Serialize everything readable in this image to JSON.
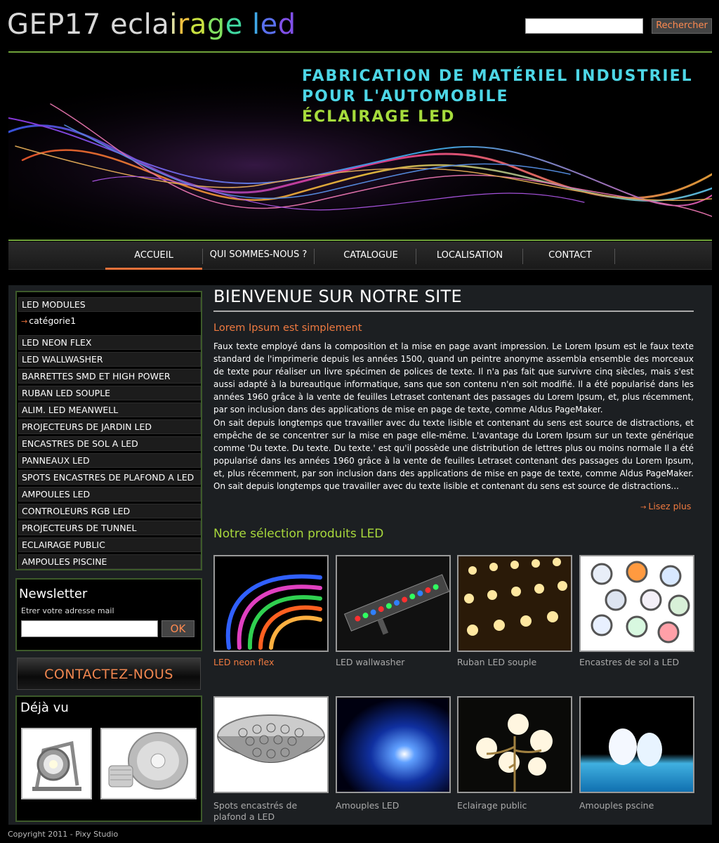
{
  "header": {
    "logo_parts": [
      {
        "text": "GEP17 ecla",
        "color": "#d8d8d8"
      },
      {
        "text": "i",
        "color": "#e0e0a0"
      },
      {
        "text": "r",
        "color": "#f0c040"
      },
      {
        "text": "a",
        "color": "#c8e040"
      },
      {
        "text": "g",
        "color": "#80e060"
      },
      {
        "text": "e ",
        "color": "#40d8a0"
      },
      {
        "text": "l",
        "color": "#40a8e8"
      },
      {
        "text": "e",
        "color": "#5a70f0"
      },
      {
        "text": "d",
        "color": "#8050e8"
      }
    ],
    "search_placeholder": "",
    "search_button": "Rechercher"
  },
  "banner": {
    "line1": "FABRICATION DE MATÉRIEL INDUSTRIEL",
    "line2": "POUR L'AUTOMOBILE",
    "line3": "ÉCLAIRAGE LED"
  },
  "nav": {
    "items": [
      "ACCUEIL",
      "QUI SOMMES-NOUS ?",
      "CATALOGUE",
      "LOCALISATION",
      "CONTACT"
    ]
  },
  "sidebar": {
    "categories": [
      "LED MODULES",
      "LED NEON FLEX",
      "LED WALLWASHER",
      "BARRETTES SMD ET HIGH POWER",
      "RUBAN LED SOUPLE",
      "ALIM. LED MEANWELL",
      "PROJECTEURS DE JARDIN LED",
      "ENCASTRES DE SOL A LED",
      "PANNEAUX LED",
      "SPOTS ENCASTRES DE PLAFOND A LED",
      "AMPOULES LED",
      "CONTROLEURS RGB LED",
      "PROJECTEURS DE TUNNEL",
      "ECLAIRAGE PUBLIC",
      "AMPOULES PISCINE"
    ],
    "subcategory": "catégorie1",
    "newsletter": {
      "title": "Newsletter",
      "label": "Etrer votre adresse mail",
      "button": "OK"
    },
    "contact": "CONTACTEZ-NOUS",
    "seen_title": "Déjà vu"
  },
  "content": {
    "title": "BIENVENUE SUR NOTRE SITE",
    "subtitle": "Lorem Ipsum est simplement",
    "paragraph1": "Faux texte employé dans la composition et la mise en page avant impression. Le Lorem Ipsum est le faux texte standard de l'imprimerie depuis les années 1500, quand un peintre anonyme assembla ensemble des morceaux de texte pour réaliser un livre spécimen de polices de texte. Il n'a pas fait que survivre cinq siècles, mais s'est aussi adapté à la bureautique informatique, sans que son contenu n'en soit modifié. Il a été popularisé dans les années 1960 grâce à la vente de feuilles Letraset contenant des passages du Lorem Ipsum, et, plus récemment, par son inclusion dans des applications de mise en page de texte, comme Aldus PageMaker.",
    "paragraph2": "On sait depuis longtemps que travailler avec du texte lisible et contenant du sens est source de distractions, et empêche de se concentrer sur la mise en page elle-même. L'avantage du Lorem Ipsum sur un texte générique comme 'Du texte. Du texte. Du texte.' est qu'il possède une distribution de lettres plus ou moins normale Il a été popularisé dans les années 1960 grâce à la vente de feuilles Letraset contenant des passages du Lorem Ipsum, et, plus récemment, par son inclusion dans des applications de mise en page de texte, comme Aldus PageMaker. On sait depuis longtemps que travailler avec du texte lisible et contenant du sens est source de distractions...",
    "read_more": "Lisez plus",
    "selection_title": "Notre sélection produits LED",
    "products": [
      "LED neon flex",
      "LED wallwasher",
      "Ruban LED souple",
      "Encastres de sol a LED",
      "Spots encastrés de plafond a LED",
      "Amouples LED",
      "Eclairage public",
      "Amouples pscine"
    ]
  },
  "footer": "Copyright 2011 - Pixy Studio"
}
